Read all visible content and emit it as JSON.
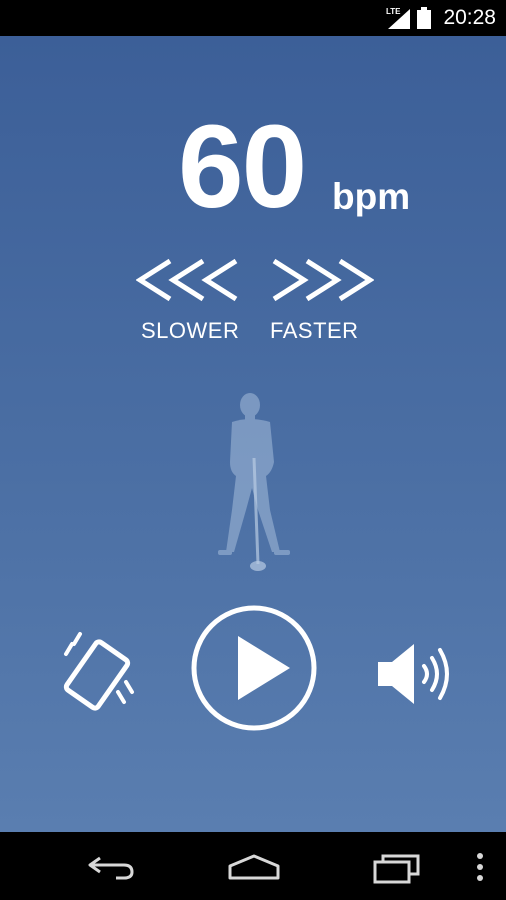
{
  "status_bar": {
    "network": "LTE",
    "time": "20:28",
    "icons": [
      "signal-icon",
      "battery-icon"
    ]
  },
  "metronome": {
    "tempo_value": "60",
    "tempo_unit": "bpm",
    "slower_arrows": "<<<",
    "faster_arrows": ">>>",
    "slower_label": "SLOWER",
    "faster_label": "FASTER"
  },
  "controls": {
    "icons": [
      "vibrate-icon",
      "play-icon",
      "sound-icon"
    ]
  },
  "nav_bar": {
    "icons": [
      "back-icon",
      "home-icon",
      "recent-apps-icon",
      "overflow-menu-icon"
    ]
  },
  "colors": {
    "background_top": "#3c5f98",
    "background_bottom": "#5a7eb0",
    "foreground": "#ffffff"
  }
}
